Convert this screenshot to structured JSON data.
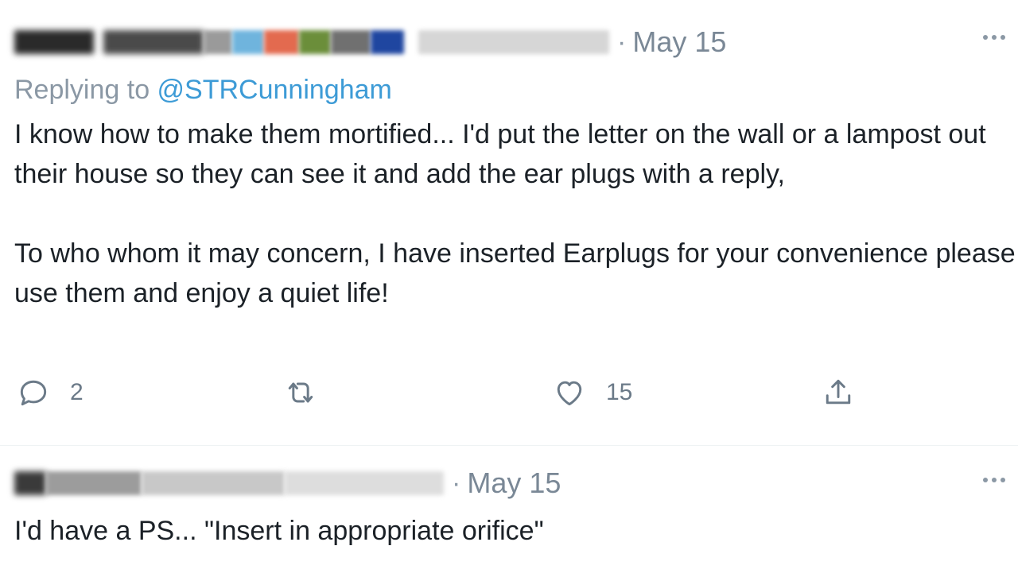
{
  "tweets": [
    {
      "name_display": "Derek",
      "handle_display": "@",
      "date": "May 15",
      "separator": "·",
      "replying_label": "Replying to ",
      "replying_handle": "@STRCunningham",
      "paragraph1": "I know how to make them mortified... I'd put the letter on the wall or a lampost out their house so they can see it and add the ear plugs with a reply,",
      "paragraph2": "To who whom it may concern, I have inserted Earplugs for your convenience please use them and enjoy a quiet life!",
      "reply_count": "2",
      "retweet_count": "",
      "like_count": "15"
    },
    {
      "date": "May 15",
      "separator": "·",
      "text": "I'd have a PS... \"Insert in appropriate orifice\""
    }
  ],
  "icons": {
    "reply": "reply-icon",
    "retweet": "retweet-icon",
    "like": "heart-icon",
    "share": "share-icon",
    "more": "more-icon"
  },
  "colors": {
    "link": "#3d9bd6",
    "muted": "#8b98a5"
  }
}
